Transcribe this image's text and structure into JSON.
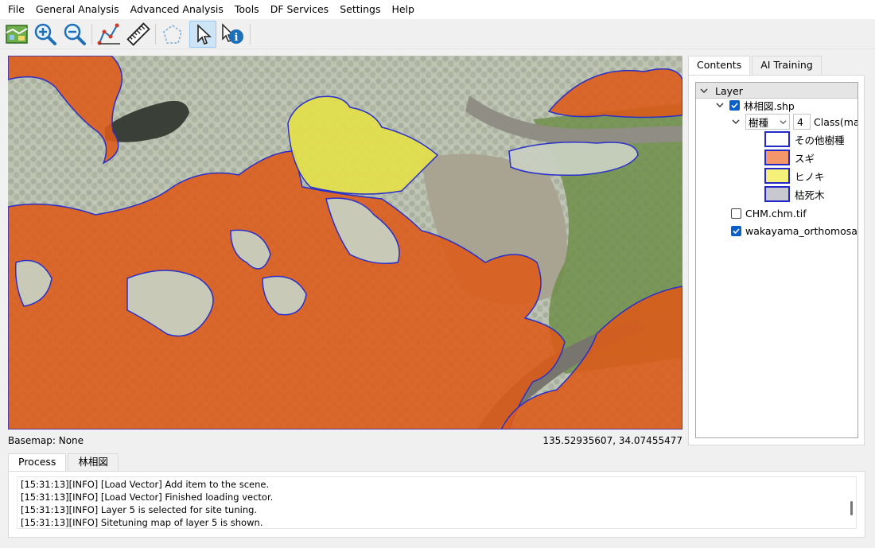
{
  "menu": [
    "File",
    "General Analysis",
    "Advanced Analysis",
    "Tools",
    "DF Services",
    "Settings",
    "Help"
  ],
  "toolbar": [
    {
      "name": "open-map-icon",
      "active": false
    },
    {
      "name": "zoom-in-icon",
      "active": false
    },
    {
      "name": "zoom-out-icon",
      "active": false
    },
    {
      "name": "measure-area-icon",
      "active": false
    },
    {
      "name": "ruler-icon",
      "active": false
    },
    {
      "name": "polygon-select-icon",
      "active": false
    },
    {
      "name": "pointer-icon",
      "active": true
    },
    {
      "name": "info-pointer-icon",
      "active": false
    }
  ],
  "status": {
    "basemap": "Basemap: None",
    "coordinates": "135.52935607, 34.07455477"
  },
  "side_tabs": [
    {
      "label": "Contents",
      "active": true
    },
    {
      "label": "AI Training",
      "active": false
    }
  ],
  "tree": {
    "header": "Layer",
    "layer1": {
      "name": "林相図.shp",
      "checked": true
    },
    "field": {
      "value": "樹種",
      "count": "4",
      "label": "Class(max"
    },
    "classes": [
      {
        "label": "その他樹種",
        "color": "#ffffff"
      },
      {
        "label": "スギ",
        "color": "#f4956a"
      },
      {
        "label": "ヒノキ",
        "color": "#f5f07a"
      },
      {
        "label": "枯死木",
        "color": "#c8c8d0"
      }
    ],
    "layer2": {
      "name": "CHM.chm.tif",
      "checked": false
    },
    "layer3": {
      "name": "wakayama_orthomosa...",
      "checked": true
    }
  },
  "bottom_tabs": [
    {
      "label": "Process",
      "active": true
    },
    {
      "label": "林相図",
      "active": false
    }
  ],
  "log": [
    "[15:31:13][INFO] [Load Vector] Add item to the scene.",
    "[15:31:13][INFO] [Load Vector] Finished loading vector.",
    "[15:31:13][INFO] Layer 5 is selected for site tuning.",
    "[15:31:13][INFO] Sitetuning map of layer 5 is shown."
  ],
  "colors": {
    "sugi": "#dd5a18",
    "hinoki": "#e3e04a",
    "boundary": "#2a30c8",
    "other": "#c8cfc0",
    "selected_tool": "#cde4f7"
  }
}
